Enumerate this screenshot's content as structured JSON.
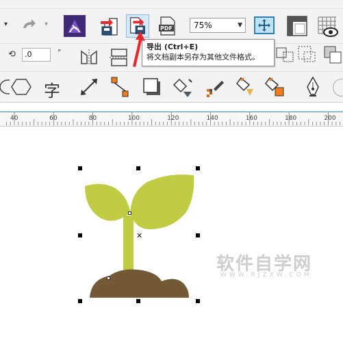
{
  "zoom": {
    "value": "75%"
  },
  "property_bar": {
    "angle_value": ".0",
    "degree_symbol": "°"
  },
  "tooltip": {
    "title": "导出 (Ctrl+E)",
    "description": "将文档副本另存为其他文件格式。"
  },
  "toolbox": {
    "text_tool_glyph": "字"
  },
  "ruler": {
    "labels": [
      "40",
      "60",
      "80",
      "100",
      "120",
      "140",
      "160",
      "180",
      "200"
    ]
  },
  "watermark": {
    "text": "软件自学网",
    "sub": "WWW.RJZXW.COM"
  },
  "colors": {
    "leaf": "#c0cc44",
    "stem": "#c0cc44",
    "soil": "#735937",
    "accent_arrow": "#e8262c"
  }
}
